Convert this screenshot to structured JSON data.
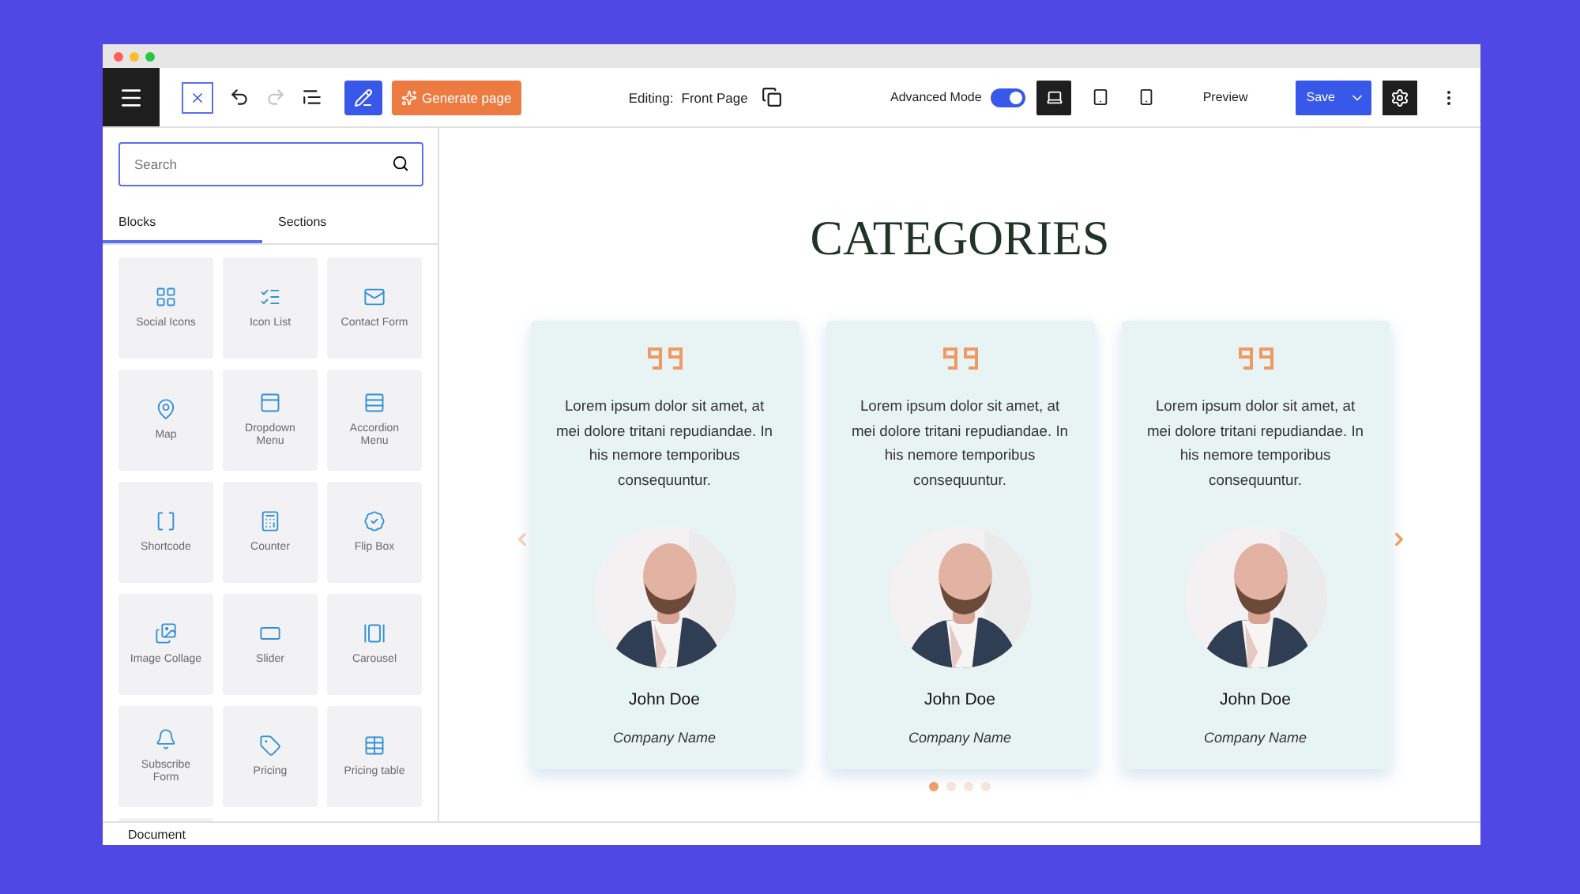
{
  "toolbar": {
    "generate_button": "Generate page",
    "editing_label": "Editing:",
    "page_name": "Front Page",
    "redo_disabled": true,
    "advanced_mode": {
      "label": "Advanced Mode",
      "on": true
    },
    "devices": [
      {
        "kind": "desktop",
        "selected": true
      },
      {
        "kind": "tablet",
        "selected": false
      },
      {
        "kind": "mobile",
        "selected": false
      }
    ],
    "preview": "Preview",
    "save": "Save"
  },
  "sidebar": {
    "search": {
      "placeholder": "Search"
    },
    "tabs": [
      {
        "label": "Blocks",
        "selected": true
      },
      {
        "label": "Sections",
        "selected": false
      }
    ],
    "blocks": [
      {
        "kind": "social",
        "label": "Social Icons"
      },
      {
        "kind": "iconlist",
        "label": "Icon List"
      },
      {
        "kind": "contact",
        "label": "Contact Form"
      },
      {
        "kind": "map",
        "label": "Map"
      },
      {
        "kind": "dropdown",
        "label": "Dropdown Menu"
      },
      {
        "kind": "accordion",
        "label": "Accordion Menu"
      },
      {
        "kind": "shortcode",
        "label": "Shortcode"
      },
      {
        "kind": "counter",
        "label": "Counter"
      },
      {
        "kind": "flipbox",
        "label": "Flip Box"
      },
      {
        "kind": "collage",
        "label": "Image Collage"
      },
      {
        "kind": "slider",
        "label": "Slider"
      },
      {
        "kind": "carousel",
        "label": "Carousel"
      },
      {
        "kind": "subscribe",
        "label": "Subscribe Form"
      },
      {
        "kind": "pricing",
        "label": "Pricing"
      },
      {
        "kind": "pricingtable",
        "label": "Pricing table"
      },
      {
        "kind": "blank"
      }
    ]
  },
  "canvas": {
    "heading": "CATEGORIES",
    "testimonials": [
      {
        "quote": "Lorem ipsum dolor sit amet, at mei dolore tritani repudiandae. In his nemore temporibus consequuntur.",
        "name": "John Doe",
        "company": "Company Name"
      },
      {
        "quote": "Lorem ipsum dolor sit amet, at mei dolore tritani repudiandae. In his nemore temporibus consequuntur.",
        "name": "John Doe",
        "company": "Company Name"
      },
      {
        "quote": "Lorem ipsum dolor sit amet, at mei dolore tritani repudiandae. In his nemore temporibus consequuntur.",
        "name": "John Doe",
        "company": "Company Name"
      }
    ],
    "dots": [
      {
        "selected": true
      },
      {
        "selected": false
      },
      {
        "selected": false
      },
      {
        "selected": false
      }
    ]
  },
  "footer": {
    "breadcrumb": "Document"
  }
}
